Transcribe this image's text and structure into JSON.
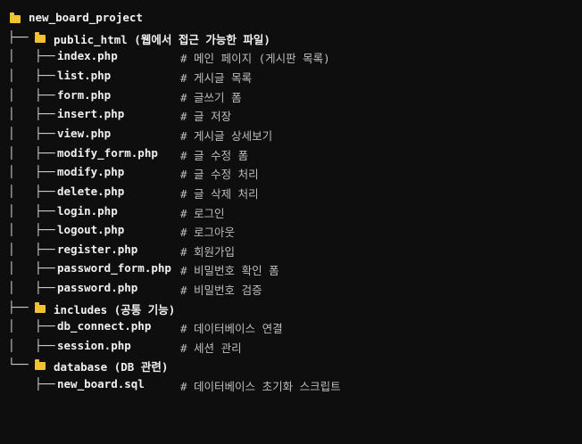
{
  "tree": {
    "root": {
      "name": "new_board_project"
    },
    "public_html": {
      "label": "public_html (웹에서 접근 가능한 파일)",
      "files": [
        {
          "name": "index.php",
          "comment": "# 메인 페이지 (게시판 목록)"
        },
        {
          "name": "list.php",
          "comment": "# 게시글 목록"
        },
        {
          "name": "form.php",
          "comment": "# 글쓰기 폼"
        },
        {
          "name": "insert.php",
          "comment": "# 글 저장"
        },
        {
          "name": "view.php",
          "comment": "# 게시글 상세보기"
        },
        {
          "name": "modify_form.php",
          "comment": "# 글 수정 폼"
        },
        {
          "name": "modify.php",
          "comment": "# 글 수정 처리"
        },
        {
          "name": "delete.php",
          "comment": "# 글 삭제 처리"
        },
        {
          "name": "login.php",
          "comment": "# 로그인"
        },
        {
          "name": "logout.php",
          "comment": "# 로그아웃"
        },
        {
          "name": "register.php",
          "comment": "# 회원가입"
        },
        {
          "name": "password_form.php",
          "comment": "# 비밀번호 확인 폼"
        },
        {
          "name": "password.php",
          "comment": "# 비밀번호 검증"
        }
      ]
    },
    "includes": {
      "label": "includes (공통 기능)",
      "files": [
        {
          "name": "db_connect.php",
          "comment": "# 데이터베이스 연결"
        },
        {
          "name": "session.php",
          "comment": "# 세션 관리"
        }
      ]
    },
    "database": {
      "label": "database (DB 관련)",
      "files": [
        {
          "name": "new_board.sql",
          "comment": "# 데이터베이스 초기화 스크립트"
        }
      ]
    },
    "guides": {
      "branch": "├── ",
      "last": "└── ",
      "pipe": "│   ",
      "blank": "    "
    },
    "icons": {
      "folder": "folder-icon",
      "folder_color": "#f2c230"
    }
  }
}
